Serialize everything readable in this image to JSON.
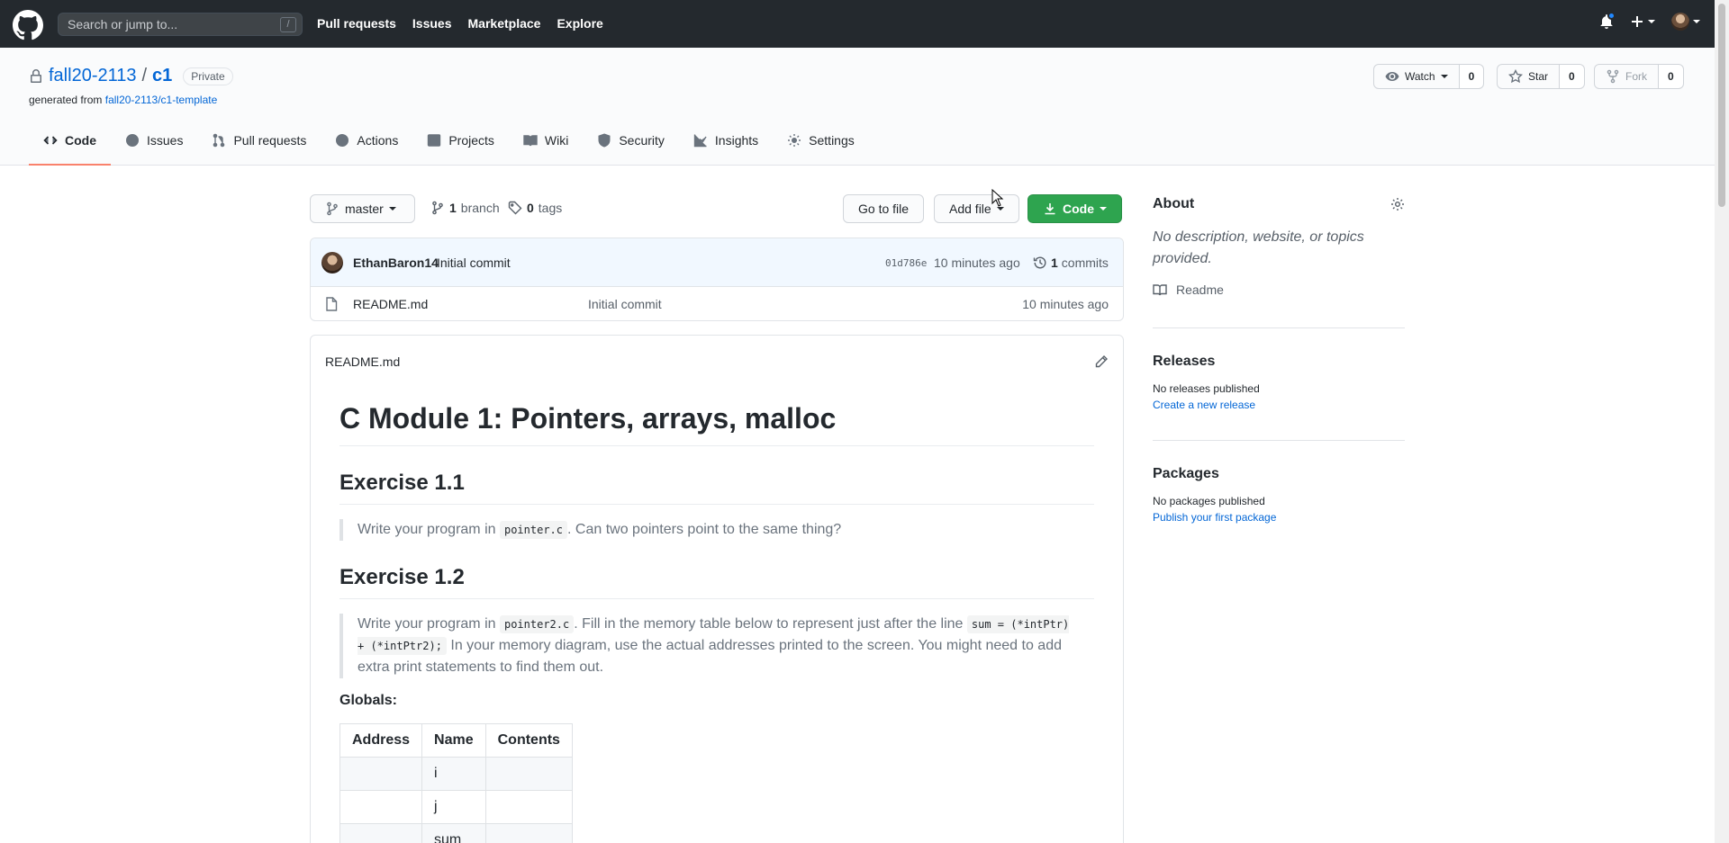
{
  "header": {
    "search_placeholder": "Search or jump to...",
    "search_shortcut": "/",
    "nav": [
      "Pull requests",
      "Issues",
      "Marketplace",
      "Explore"
    ]
  },
  "repo": {
    "owner": "fall20-2113",
    "separator": "/",
    "name": "c1",
    "visibility": "Private",
    "generated_prefix": "generated from",
    "template": "fall20-2113/c1-template",
    "watch": {
      "label": "Watch",
      "count": "0"
    },
    "star": {
      "label": "Star",
      "count": "0"
    },
    "fork": {
      "label": "Fork",
      "count": "0"
    }
  },
  "tabs": [
    "Code",
    "Issues",
    "Pull requests",
    "Actions",
    "Projects",
    "Wiki",
    "Security",
    "Insights",
    "Settings"
  ],
  "toolbar": {
    "branch": "master",
    "branches_count": "1",
    "branches_label": "branch",
    "tags_count": "0",
    "tags_label": "tags",
    "go_to_file": "Go to file",
    "add_file": "Add file",
    "code": "Code"
  },
  "commit": {
    "author": "EthanBaron14",
    "message": "Initial commit",
    "sha": "01d786e",
    "time": "10 minutes ago",
    "commits_count": "1",
    "commits_label": "commits"
  },
  "files": [
    {
      "name": "README.md",
      "message": "Initial commit",
      "time": "10 minutes ago"
    }
  ],
  "readme": {
    "filename": "README.md",
    "h1": "C Module 1: Pointers, arrays, malloc",
    "ex1_title": "Exercise 1.1",
    "ex1_pre": "Write your program in ",
    "ex1_code": "pointer.c",
    "ex1_post": ". Can two pointers point to the same thing?",
    "ex2_title": "Exercise 1.2",
    "ex2_pre": "Write your program in ",
    "ex2_code1": "pointer2.c",
    "ex2_mid": ". Fill in the memory table below to represent just after the line ",
    "ex2_code2": "sum = (*intPtr) + (*intPtr2);",
    "ex2_post": " In your memory diagram, use the actual addresses printed to the screen. You might need to add extra print statements to find them out.",
    "globals": "Globals:",
    "table_headers": [
      "Address",
      "Name",
      "Contents"
    ],
    "table_rows": [
      [
        "",
        "i",
        ""
      ],
      [
        "",
        "j",
        ""
      ],
      [
        "",
        "sum",
        ""
      ]
    ]
  },
  "sidebar": {
    "about_title": "About",
    "about_desc": "No description, website, or topics provided.",
    "readme_label": "Readme",
    "releases_title": "Releases",
    "releases_none": "No releases published",
    "releases_link": "Create a new release",
    "packages_title": "Packages",
    "packages_none": "No packages published",
    "packages_link": "Publish your first package"
  }
}
